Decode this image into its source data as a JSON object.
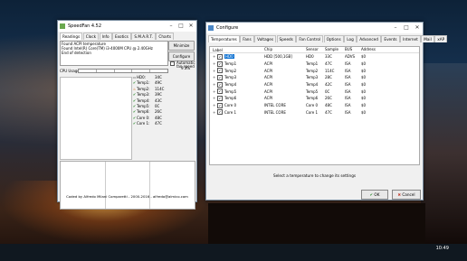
{
  "taskbar": {
    "time": "10:49",
    "date": ""
  },
  "speedfan": {
    "title": "SpeedFan 4.52",
    "tabs": [
      "Readings",
      "Clock",
      "Info",
      "Exotics",
      "S.M.A.R.T.",
      "Charts"
    ],
    "log_lines": [
      "Found ACPI temperature",
      "Found Intel(R) Core(TM) i3-4000M CPU @ 2.40GHz",
      "End of detection"
    ],
    "minimize_label": "Minimize",
    "configure_label": "Configure",
    "auto_fan_label": "Automatic fan speed",
    "cpu_usage_label": "CPU Usage",
    "cpu_usage_value": "9.3%",
    "temps": [
      {
        "name": "HD0:",
        "value": "34C",
        "icon": "disk-icon"
      },
      {
        "name": "Temp1:",
        "value": "49C",
        "icon": "check-icon"
      },
      {
        "name": "Temp2:",
        "value": "114C",
        "icon": "fire-icon"
      },
      {
        "name": "Temp3:",
        "value": "39C",
        "icon": "check-icon"
      },
      {
        "name": "Temp4:",
        "value": "43C",
        "icon": "check-icon"
      },
      {
        "name": "Temp5:",
        "value": "0C",
        "icon": "check-icon"
      },
      {
        "name": "Temp6:",
        "value": "26C",
        "icon": "check-icon"
      },
      {
        "name": "Core 0:",
        "value": "48C",
        "icon": "check-icon"
      },
      {
        "name": "Core 1:",
        "value": "47C",
        "icon": "check-icon"
      }
    ],
    "footer": "Coded by Alfredo Milani Comparetti - 2000-2016 - alfredo@almico.com"
  },
  "configure": {
    "title": "Configure",
    "tabs": [
      "Temperatures",
      "Fans",
      "Voltages",
      "Speeds",
      "Fan Control",
      "Options",
      "Log",
      "Advanced",
      "Events",
      "Internet",
      "Mail",
      "xAP"
    ],
    "columns": [
      "Label",
      "Chip",
      "Sensor",
      "Sample",
      "BUS",
      "Address"
    ],
    "rows": [
      {
        "label": "HD0",
        "chip": "HDD [500,1GB]",
        "sensor": "HD0",
        "sample": "33C",
        "bus": "ADVS",
        "address": "$0"
      },
      {
        "label": "Temp1",
        "chip": "ACPI",
        "sensor": "Temp1",
        "sample": "47C",
        "bus": "ISA",
        "address": "$0"
      },
      {
        "label": "Temp2",
        "chip": "ACPI",
        "sensor": "Temp2",
        "sample": "114C",
        "bus": "ISA",
        "address": "$0"
      },
      {
        "label": "Temp3",
        "chip": "ACPI",
        "sensor": "Temp3",
        "sample": "28C",
        "bus": "ISA",
        "address": "$0"
      },
      {
        "label": "Temp4",
        "chip": "ACPI",
        "sensor": "Temp4",
        "sample": "42C",
        "bus": "ISA",
        "address": "$0"
      },
      {
        "label": "Temp5",
        "chip": "ACPI",
        "sensor": "Temp5",
        "sample": "0C",
        "bus": "ISA",
        "address": "$0"
      },
      {
        "label": "Temp6",
        "chip": "ACPI",
        "sensor": "Temp6",
        "sample": "26C",
        "bus": "ISA",
        "address": "$0"
      },
      {
        "label": "Core 0",
        "chip": "INTEL CORE",
        "sensor": "Core 0",
        "sample": "48C",
        "bus": "ISA",
        "address": "$0"
      },
      {
        "label": "Core 1",
        "chip": "INTEL CORE",
        "sensor": "Core 1",
        "sample": "47C",
        "bus": "ISA",
        "address": "$0"
      }
    ],
    "hint": "Select a temperature to change its settings",
    "ok_label": "OK",
    "cancel_label": "Cancel"
  },
  "colors": {
    "selection": "#0b6fd0",
    "ok_green": "#2a8a2a",
    "cancel_red": "#c0392b"
  }
}
